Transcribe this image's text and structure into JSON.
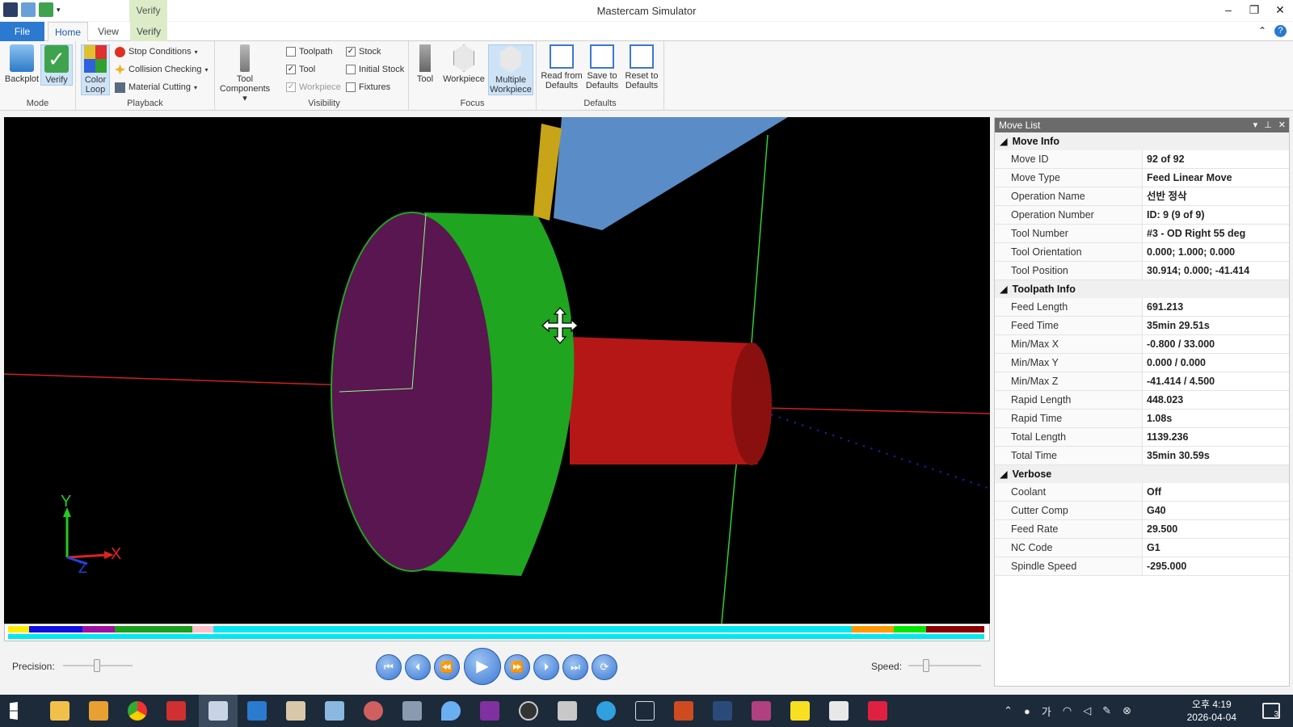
{
  "app": {
    "title": "Mastercam Simulator",
    "contextual_tab": "Verify"
  },
  "window_controls": {
    "minimize": "–",
    "restore": "❐",
    "close": "✕"
  },
  "tabs": {
    "file": "File",
    "home": "Home",
    "view": "View",
    "verify": "Verify"
  },
  "ribbon": {
    "mode": {
      "label": "Mode",
      "backplot": "Backplot",
      "verify": "Verify"
    },
    "playback": {
      "label": "Playback",
      "color_loop": "Color Loop",
      "stop_conditions": "Stop Conditions",
      "collision_checking": "Collision Checking",
      "material_cutting": "Material Cutting",
      "tool_components": "Tool Components"
    },
    "visibility": {
      "label": "Visibility",
      "toolpath": "Toolpath",
      "tool": "Tool",
      "workpiece": "Workpiece",
      "stock": "Stock",
      "initial_stock": "Initial Stock",
      "fixtures": "Fixtures"
    },
    "focus": {
      "label": "Focus",
      "tool": "Tool",
      "workpiece": "Workpiece",
      "multiple_workpiece": "Multiple Workpiece"
    },
    "defaults": {
      "label": "Defaults",
      "read": "Read from Defaults",
      "save": "Save to Defaults",
      "reset": "Reset to Defaults"
    }
  },
  "viewport": {
    "axis_x": "X",
    "axis_y": "Y",
    "axis_z": "Z"
  },
  "playback": {
    "precision_label": "Precision:",
    "speed_label": "Speed:"
  },
  "move_list": {
    "title": "Move List",
    "move_info": {
      "label": "Move Info",
      "rows": [
        {
          "k": "Move ID",
          "v": "92 of 92"
        },
        {
          "k": "Move Type",
          "v": "Feed Linear Move"
        },
        {
          "k": "Operation Name",
          "v": "선반 정삭"
        },
        {
          "k": "Operation Number",
          "v": "ID: 9 (9 of 9)"
        },
        {
          "k": "Tool Number",
          "v": "#3 - OD Right 55 deg"
        },
        {
          "k": "Tool Orientation",
          "v": "0.000; 1.000; 0.000"
        },
        {
          "k": "Tool Position",
          "v": "30.914; 0.000; -41.414"
        }
      ]
    },
    "toolpath_info": {
      "label": "Toolpath Info",
      "rows": [
        {
          "k": "Feed Length",
          "v": "691.213"
        },
        {
          "k": "Feed Time",
          "v": "35min 29.51s"
        },
        {
          "k": "Min/Max X",
          "v": "-0.800 / 33.000"
        },
        {
          "k": "Min/Max Y",
          "v": "0.000 / 0.000"
        },
        {
          "k": "Min/Max Z",
          "v": "-41.414 / 4.500"
        },
        {
          "k": "Rapid Length",
          "v": "448.023"
        },
        {
          "k": "Rapid Time",
          "v": "1.08s"
        },
        {
          "k": "Total Length",
          "v": "1139.236"
        },
        {
          "k": "Total Time",
          "v": "35min 30.59s"
        }
      ]
    },
    "verbose": {
      "label": "Verbose",
      "rows": [
        {
          "k": "Coolant",
          "v": "Off"
        },
        {
          "k": "Cutter Comp",
          "v": "G40"
        },
        {
          "k": "Feed Rate",
          "v": "29.500"
        },
        {
          "k": "NC Code",
          "v": "G1"
        },
        {
          "k": "Spindle Speed",
          "v": "-295.000"
        }
      ]
    }
  },
  "taskbar": {
    "time": "오후 4:19",
    "date": "2026-04-04",
    "notifications": "3"
  },
  "colors": {
    "accent": "#2b79d0",
    "stock_green": "#22a822",
    "stock_purple": "#5a1650",
    "part_red": "#b01818",
    "tool_blue": "#5a8cc8"
  }
}
